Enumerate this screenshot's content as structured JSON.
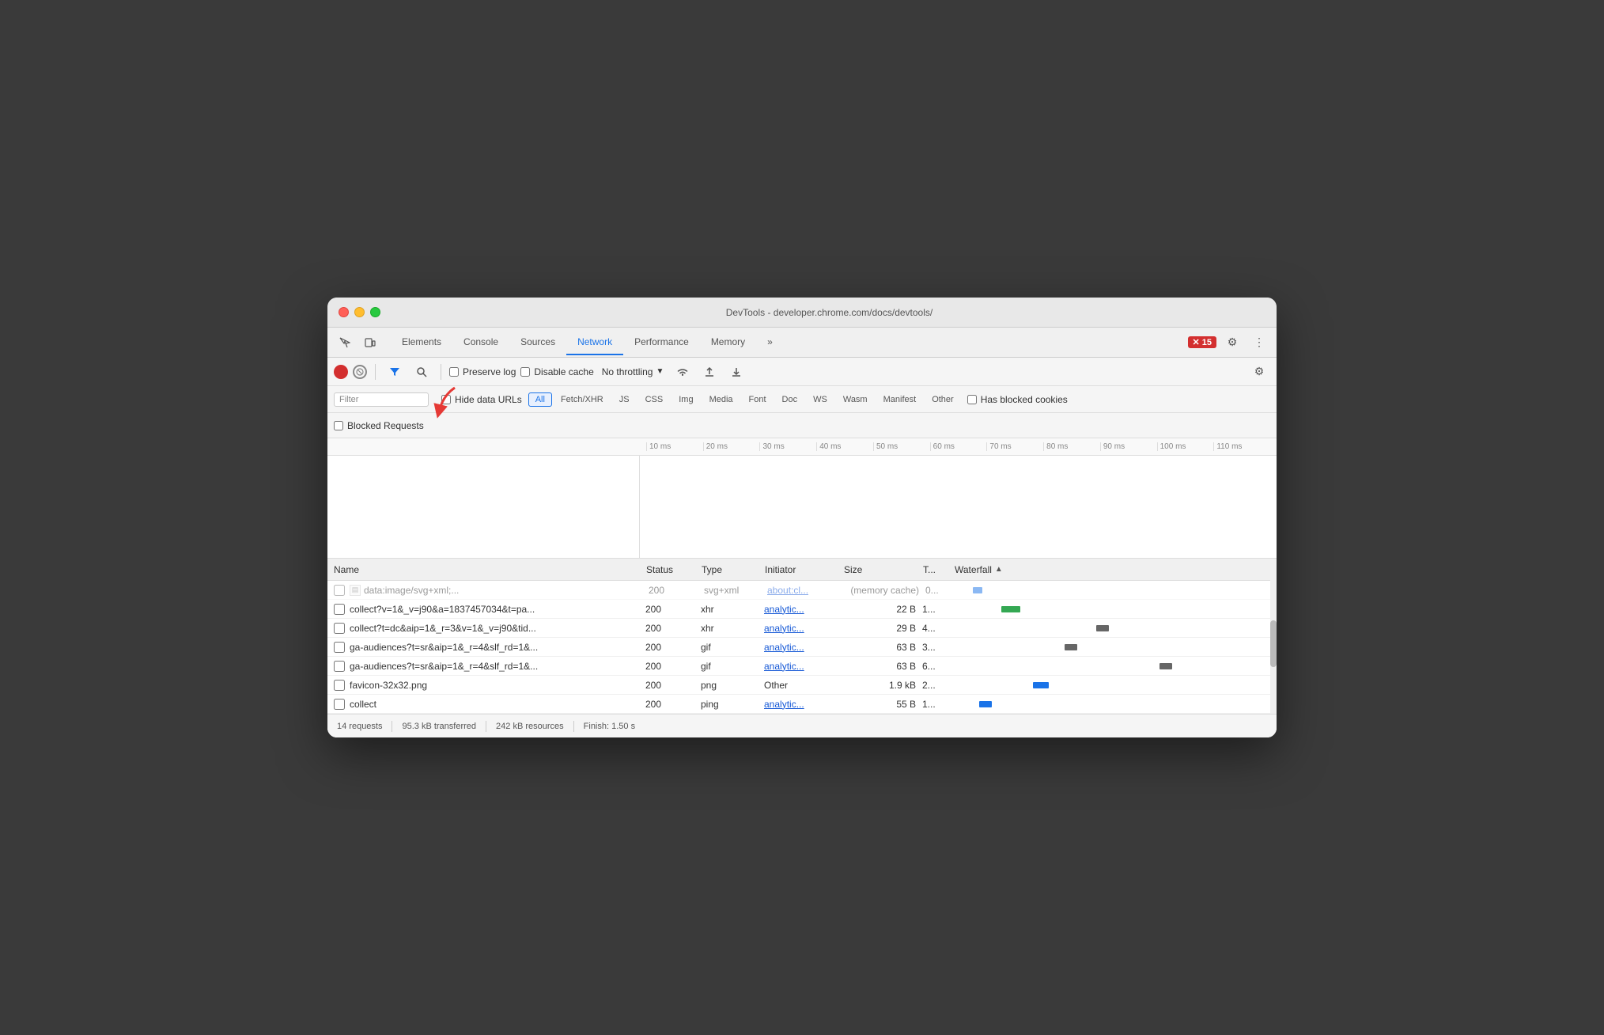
{
  "window": {
    "title": "DevTools - developer.chrome.com/docs/devtools/"
  },
  "tabs": {
    "items": [
      {
        "label": "Elements",
        "active": false
      },
      {
        "label": "Console",
        "active": false
      },
      {
        "label": "Sources",
        "active": false
      },
      {
        "label": "Network",
        "active": true
      },
      {
        "label": "Performance",
        "active": false
      },
      {
        "label": "Memory",
        "active": false
      }
    ],
    "more_label": "»",
    "error_count": "15",
    "settings_label": "⚙",
    "more_options_label": "⋮"
  },
  "network_toolbar": {
    "preserve_log_label": "Preserve log",
    "disable_cache_label": "Disable cache",
    "throttle_label": "No throttling",
    "throttle_arrow": "▼"
  },
  "filter_bar": {
    "filter_placeholder": "Filter",
    "hide_data_urls_label": "Hide data URLs",
    "filter_types": [
      "All",
      "Fetch/XHR",
      "JS",
      "CSS",
      "Img",
      "Media",
      "Font",
      "Doc",
      "WS",
      "Wasm",
      "Manifest",
      "Other"
    ],
    "has_blocked_cookies_label": "Has blocked cookies",
    "blocked_requests_label": "Blocked Requests"
  },
  "timeline": {
    "ticks": [
      "10 ms",
      "20 ms",
      "30 ms",
      "40 ms",
      "50 ms",
      "60 ms",
      "70 ms",
      "80 ms",
      "90 ms",
      "100 ms",
      "110 ms"
    ]
  },
  "table": {
    "headers": {
      "name": "Name",
      "status": "Status",
      "type": "Type",
      "initiator": "Initiator",
      "size": "Size",
      "time": "T...",
      "waterfall": "Waterfall"
    },
    "rows": [
      {
        "name": "data:image/svg+xml;...",
        "status": "200",
        "type": "svg+xml",
        "initiator": "about:cl...",
        "size": "(memory cache)",
        "time": "0...",
        "has_icon": true,
        "wf_color": "blue",
        "wf_left": "5%",
        "wf_width": "3%"
      },
      {
        "name": "collect?v=1&_v=j90&a=1837457034&t=pa...",
        "status": "200",
        "type": "xhr",
        "initiator": "analytic...",
        "size": "22 B",
        "time": "1...",
        "has_icon": false,
        "wf_color": "green",
        "wf_left": "15%",
        "wf_width": "6%"
      },
      {
        "name": "collect?t=dc&aip=1&_r=3&v=1&_v=j90&tid...",
        "status": "200",
        "type": "xhr",
        "initiator": "analytic...",
        "size": "29 B",
        "time": "4...",
        "has_icon": false,
        "wf_color": "dark",
        "wf_left": "45%",
        "wf_width": "4%"
      },
      {
        "name": "ga-audiences?t=sr&aip=1&_r=4&slf_rd=1&...",
        "status": "200",
        "type": "gif",
        "initiator": "analytic...",
        "size": "63 B",
        "time": "3...",
        "has_icon": false,
        "wf_color": "dark",
        "wf_left": "35%",
        "wf_width": "4%"
      },
      {
        "name": "ga-audiences?t=sr&aip=1&_r=4&slf_rd=1&...",
        "status": "200",
        "type": "gif",
        "initiator": "analytic...",
        "size": "63 B",
        "time": "6...",
        "has_icon": false,
        "wf_color": "dark",
        "wf_left": "65%",
        "wf_width": "4%"
      },
      {
        "name": "favicon-32x32.png",
        "status": "200",
        "type": "png",
        "initiator": "Other",
        "size": "1.9 kB",
        "time": "2...",
        "has_icon": false,
        "wf_color": "blue",
        "wf_left": "25%",
        "wf_width": "5%",
        "initiator_plain": true
      },
      {
        "name": "collect",
        "status": "200",
        "type": "ping",
        "initiator": "analytic...",
        "size": "55 B",
        "time": "1...",
        "has_icon": false,
        "wf_color": "blue",
        "wf_left": "8%",
        "wf_width": "4%"
      }
    ]
  },
  "status_bar": {
    "requests": "14 requests",
    "transferred": "95.3 kB transferred",
    "resources": "242 kB resources",
    "finish": "Finish: 1.50 s"
  }
}
